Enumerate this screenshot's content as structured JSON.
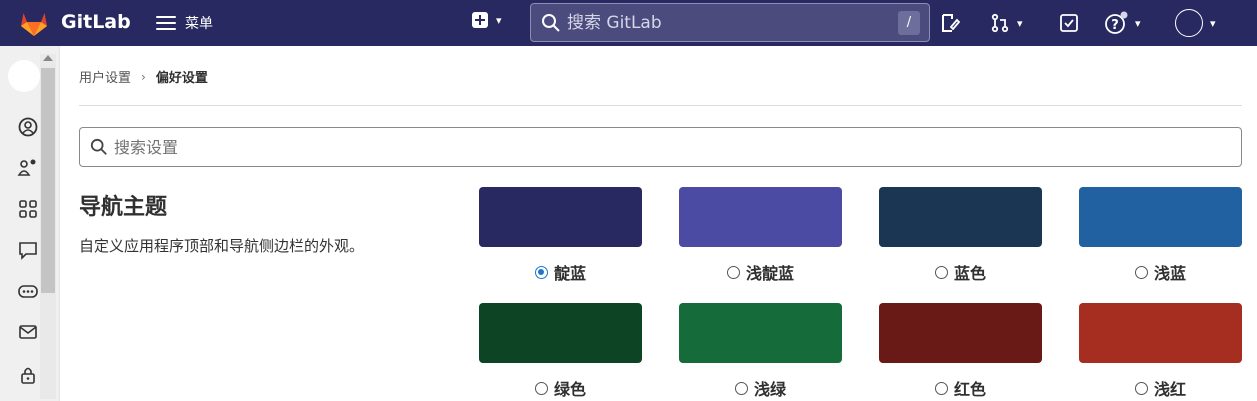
{
  "topbar": {
    "brand": "GitLab",
    "menu_label": "菜单",
    "search_placeholder": "搜索 GitLab",
    "search_shortcut": "/"
  },
  "breadcrumb": {
    "parent": "用户设置",
    "current": "偏好设置"
  },
  "settings_search": {
    "placeholder": "搜索设置"
  },
  "navigation_theme": {
    "title": "导航主题",
    "description": "自定义应用程序顶部和导航侧边栏的外观。",
    "themes": [
      {
        "label": "靛蓝",
        "color": "#292961",
        "selected": true
      },
      {
        "label": "浅靛蓝",
        "color": "#4b4ba3",
        "selected": false
      },
      {
        "label": "蓝色",
        "color": "#1a3652",
        "selected": false
      },
      {
        "label": "浅蓝",
        "color": "#2261a1",
        "selected": false
      },
      {
        "label": "绿色",
        "color": "#0d4524",
        "selected": false
      },
      {
        "label": "浅绿",
        "color": "#156b39",
        "selected": false
      },
      {
        "label": "红色",
        "color": "#691a16",
        "selected": false
      },
      {
        "label": "浅红",
        "color": "#a62e21",
        "selected": false
      }
    ]
  },
  "colors": {
    "navbar": "#292961",
    "accent": "#1f75cb"
  }
}
